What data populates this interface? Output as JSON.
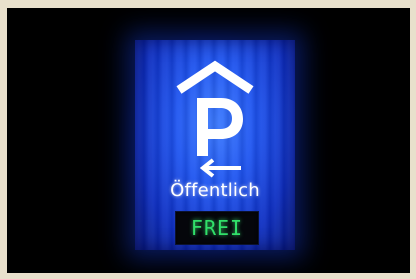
{
  "scene": {
    "description_type": "illuminated parking sign at night",
    "sign_label": "Öffentlich",
    "status_display": "FREI",
    "icons": {
      "roof": "roof-icon",
      "parking": "parking-p-icon",
      "arrow": "arrow-left-icon"
    },
    "colors": {
      "frame_background": "#e8e0cc",
      "night_background": "#000000",
      "sign_blue": "#1f55f0",
      "sign_white": "#ffffff",
      "led_green": "#31e06a"
    }
  }
}
